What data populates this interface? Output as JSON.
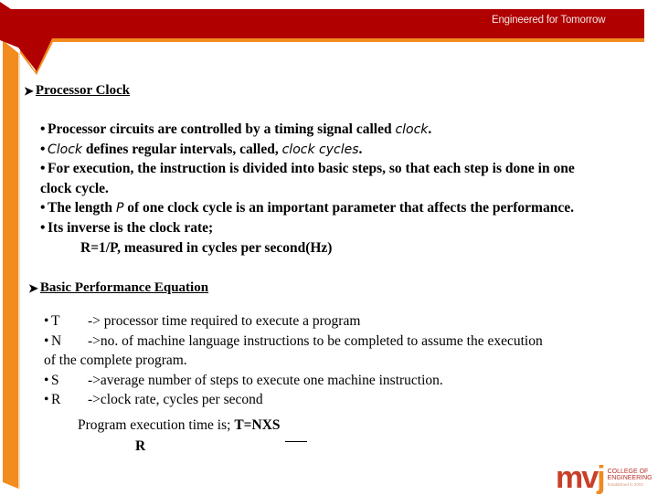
{
  "header": {
    "tagline": "Engineered for Tomorrow",
    "colors": {
      "banner": "#b00000",
      "accent": "#f28c1e"
    }
  },
  "sections": [
    {
      "title": "Processor Clock",
      "bullets": [
        {
          "parts": [
            "Processor circuits are controlled by a timing signal called ",
            "clock",
            "."
          ]
        },
        {
          "parts": [
            "Clock",
            " defines regular intervals, called, ",
            "clock cycles",
            "."
          ]
        },
        {
          "line1": "For execution, the instruction is divided into basic steps, so that each step is done in one",
          "line2": "clock cycle."
        },
        {
          "parts": [
            "The length ",
            "P",
            " of one clock cycle is an important parameter that affects the performance."
          ]
        },
        {
          "text": "Its inverse is the clock rate;"
        }
      ],
      "equation": "R=1/P, measured in cycles per second(Hz)"
    },
    {
      "title": "Basic Performance Equation",
      "terms": [
        {
          "symbol": "T",
          "desc": "-> processor time required to execute a program"
        },
        {
          "symbol": "N",
          "desc": "->no. of machine language instructions to be completed to assume the execution",
          "cont": "of the complete program."
        },
        {
          "symbol": "S",
          "desc": "->average number of steps to execute one machine instruction."
        },
        {
          "symbol": "R",
          "desc": "->clock rate, cycles per second"
        }
      ],
      "formula": {
        "prefix": "Program execution time is; ",
        "numerator": "T=NXS",
        "denominator": "R"
      }
    }
  ],
  "logo": {
    "mark": "mv",
    "mark_j": "j",
    "line1": "COLLEGE OF",
    "line2": "ENGINEERING",
    "line3": "Established in 2002"
  }
}
